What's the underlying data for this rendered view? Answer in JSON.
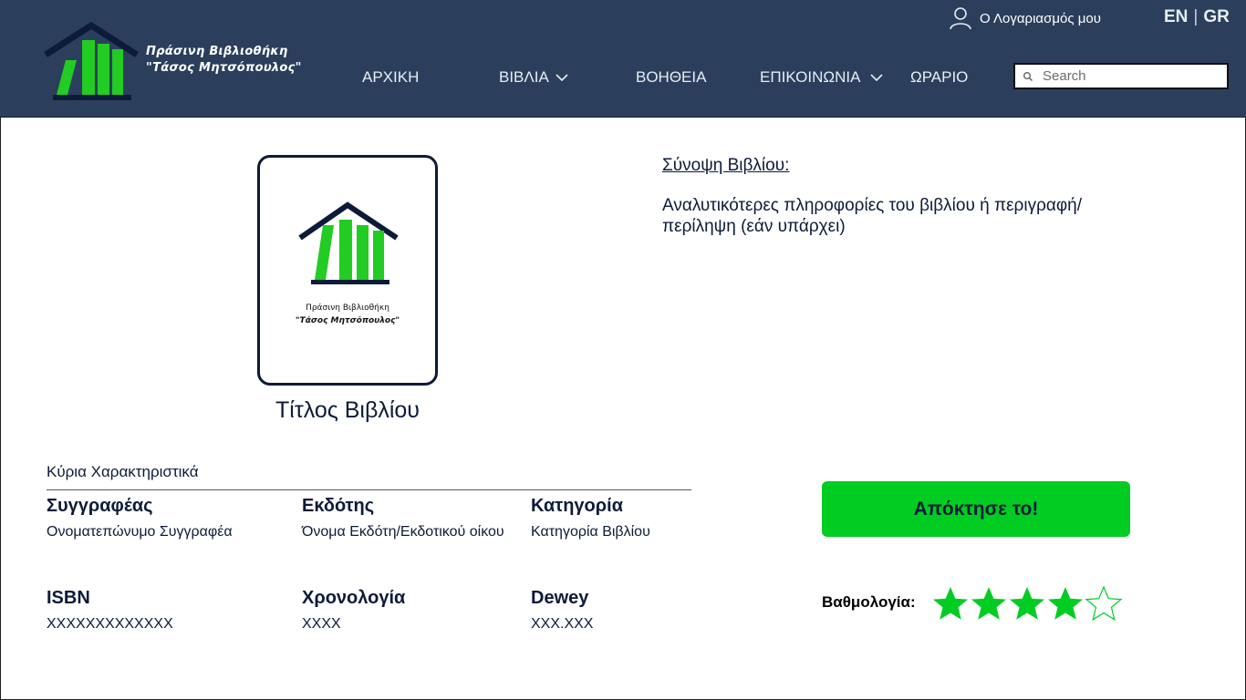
{
  "header": {
    "logo_line1": "Πράσινη Βιβλιοθήκη",
    "logo_line2": "\"Τάσος Μητσόπουλος\"",
    "account_label": "Ο Λογαριασμός μου",
    "lang_en": "EN",
    "lang_separator": "|",
    "lang_gr": "GR",
    "nav": [
      {
        "label": "ΑΡΧΙΚΗ",
        "dropdown": false
      },
      {
        "label": "ΒΙΒΛΙΑ",
        "dropdown": true
      },
      {
        "label": "ΒΟΗΘΕΙΑ",
        "dropdown": false
      },
      {
        "label": "ΕΠΙΚΟΙΝΩΝΙΑ",
        "dropdown": true
      },
      {
        "label": "ΩΡΑΡΙΟ",
        "dropdown": false
      }
    ],
    "search_placeholder": "Search"
  },
  "book": {
    "cover_line1": "Πράσινη Βιβλιοθήκη",
    "cover_line2": "\"Τάσος Μητσόπουλος\"",
    "title": "Τίτλος Βιβλίου",
    "summary_label": "Σύνοψη Βιβλίου:",
    "summary_text": "Αναλυτικότερες πληροφορίες του βιβλίου ή περιγραφή/ περίληψη (εάν υπάρχει)"
  },
  "features": {
    "heading": "Κύρια Χαρακτηριστικά",
    "items": [
      {
        "label": "Συγγραφέας",
        "value": "Ονοματεπώνυμο Συγγραφέα"
      },
      {
        "label": "Εκδότης",
        "value": "Όνομα Εκδότη/Εκδοτικού οίκου"
      },
      {
        "label": "Κατηγορία",
        "value": "Κατηγορία Βιβλίου"
      },
      {
        "label": "ISBN",
        "value": "XXXXXXXXXXXXX"
      },
      {
        "label": "Χρονολογία",
        "value": "XXXX"
      },
      {
        "label": "Dewey",
        "value": "XXX.XXX"
      }
    ]
  },
  "actions": {
    "acquire_label": "Απόκτησε το!",
    "rating_label": "Βαθμολογία:",
    "rating": 4,
    "rating_max": 5
  },
  "colors": {
    "header_bg": "#2b3f5c",
    "accent_green": "#00cc22",
    "text_dark": "#0d1b3a"
  },
  "icons": [
    "user-icon",
    "chevron-down-icon",
    "search-icon",
    "star-icon"
  ]
}
